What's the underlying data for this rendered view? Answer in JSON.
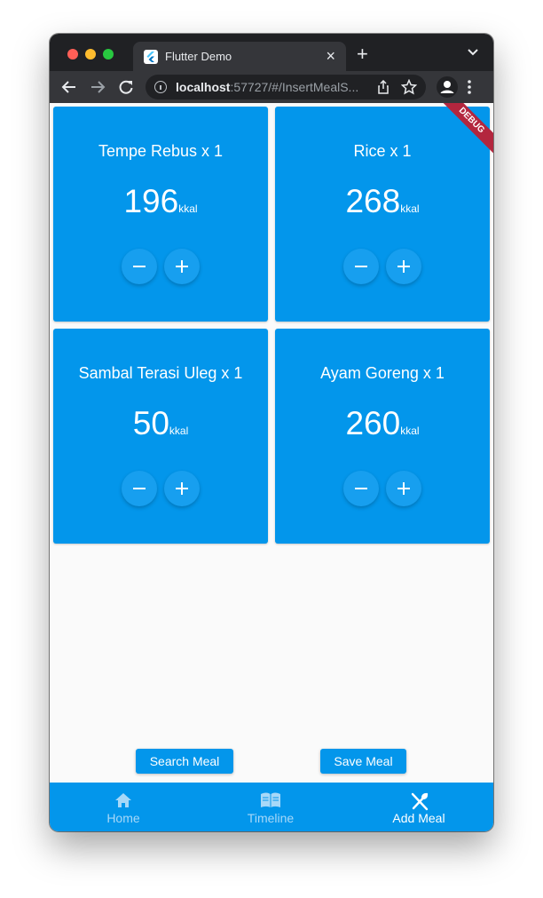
{
  "browser": {
    "tab_title": "Flutter Demo",
    "close_label": "×",
    "new_tab_label": "+",
    "url_host": "localhost",
    "url_rest": ":57727/#/InsertMealS...",
    "debug_label": "DEBUG"
  },
  "meals": [
    {
      "name": "Tempe Rebus x 1",
      "calories": "196",
      "unit": "kkal"
    },
    {
      "name": "Rice x 1",
      "calories": "268",
      "unit": "kkal"
    },
    {
      "name": "Sambal Terasi Uleg x 1",
      "calories": "50",
      "unit": "kkal"
    },
    {
      "name": "Ayam Goreng x 1",
      "calories": "260",
      "unit": "kkal"
    }
  ],
  "actions": {
    "search_label": "Search Meal",
    "save_label": "Save Meal"
  },
  "nav": {
    "items": [
      {
        "label": "Home",
        "icon": "home-icon",
        "active": false
      },
      {
        "label": "Timeline",
        "icon": "book-icon",
        "active": false
      },
      {
        "label": "Add Meal",
        "icon": "utensils-icon",
        "active": true
      }
    ]
  },
  "colors": {
    "primary": "#0396eb",
    "debug": "#b3263e",
    "chrome_dark": "#202124",
    "chrome_toolbar": "#35363a"
  }
}
